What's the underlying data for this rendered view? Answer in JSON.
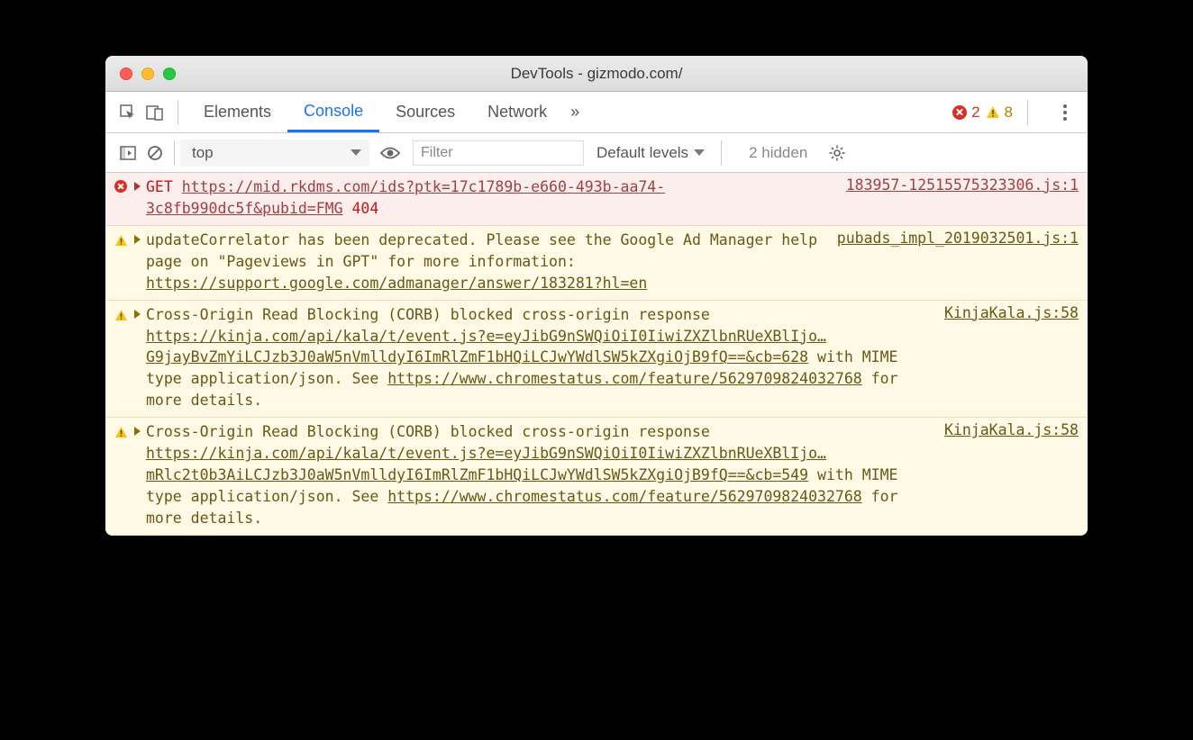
{
  "window": {
    "title": "DevTools - gizmodo.com/"
  },
  "tabs": {
    "elements": "Elements",
    "console": "Console",
    "sources": "Sources",
    "network": "Network",
    "overflow": "»"
  },
  "counters": {
    "errors": "2",
    "warnings": "8"
  },
  "toolbar": {
    "context": "top",
    "filter_placeholder": "Filter",
    "levels": "Default levels",
    "hidden": "2 hidden"
  },
  "rows": [
    {
      "type": "error",
      "method": "GET",
      "url": "https://mid.rkdms.com/ids?ptk=17c1789b-e660-493b-aa74-3c8fb990dc5f&pubid=FMG",
      "status": "404",
      "source": "183957-12515575323306.js:1"
    },
    {
      "type": "warn",
      "text_pre": "updateCorrelator has been deprecated. Please see the Google Ad Manager help page on \"Pageviews in GPT\" for more information: ",
      "url": "https://support.google.com/admanager/answer/183281?hl=en",
      "source": "pubads_impl_2019032501.js:1"
    },
    {
      "type": "warn",
      "text_pre": "Cross-Origin Read Blocking (CORB) blocked cross-origin response ",
      "url": "https://kinja.com/api/kala/t/event.js?e=eyJibG9nSWQiOiI0IiwiZXZlbnRUeXBlIjo…G9jayBvZmYiLCJzb3J0aW5nVmlldyI6ImRlZmF1bHQiLCJwYWdlSW5kZXgiOjB9fQ==&cb=628",
      "text_post": " with MIME type application/json. See ",
      "url2": "https://www.chromestatus.com/feature/5629709824032768",
      "text_end": " for more details.",
      "source": "KinjaKala.js:58"
    },
    {
      "type": "warn",
      "text_pre": "Cross-Origin Read Blocking (CORB) blocked cross-origin response ",
      "url": "https://kinja.com/api/kala/t/event.js?e=eyJibG9nSWQiOiI0IiwiZXZlbnRUeXBlIjo…mRlc2t0b3AiLCJzb3J0aW5nVmlldyI6ImRlZmF1bHQiLCJwYWdlSW5kZXgiOjB9fQ==&cb=549",
      "text_post": " with MIME type application/json. See ",
      "url2": "https://www.chromestatus.com/feature/5629709824032768",
      "text_end": " for more details.",
      "source": "KinjaKala.js:58"
    }
  ]
}
